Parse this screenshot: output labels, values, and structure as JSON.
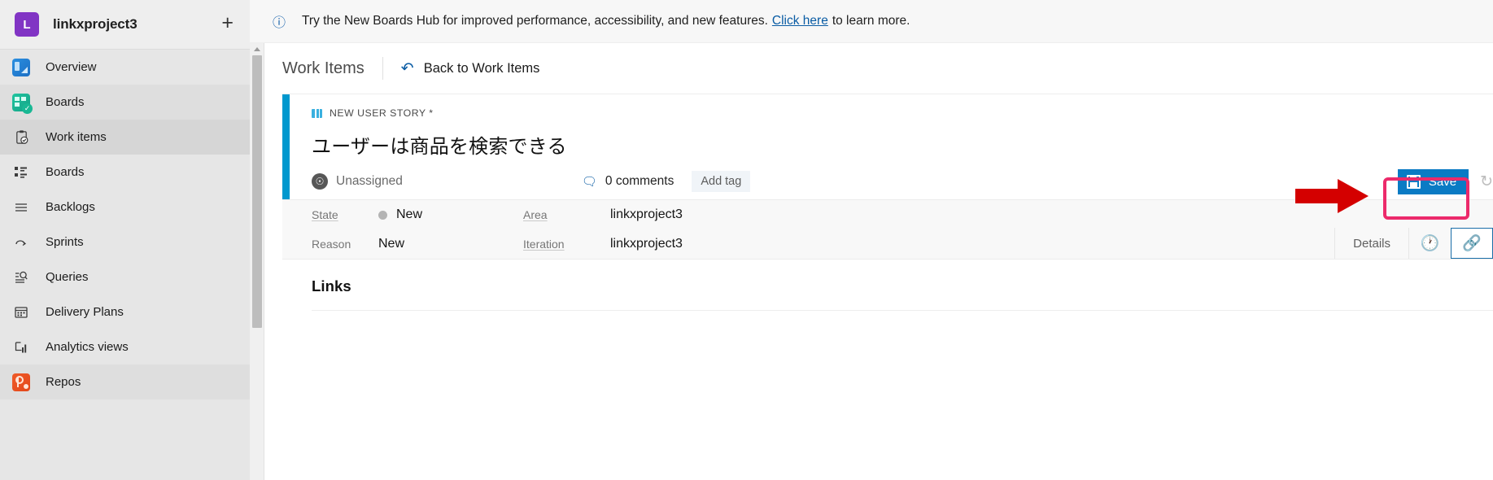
{
  "sidebar": {
    "project": {
      "initial": "L",
      "name": "linkxproject3",
      "add_label": "+"
    },
    "items": [
      {
        "label": "Overview",
        "icon": "overview-squircle-icon",
        "state": "normal"
      },
      {
        "label": "Boards",
        "icon": "boards-squircle-icon",
        "state": "group"
      },
      {
        "label": "Work items",
        "icon": "work-items-icon",
        "state": "selected"
      },
      {
        "label": "Boards",
        "icon": "boards-grid-icon",
        "state": "normal"
      },
      {
        "label": "Backlogs",
        "icon": "backlogs-icon",
        "state": "normal"
      },
      {
        "label": "Sprints",
        "icon": "sprints-icon",
        "state": "normal"
      },
      {
        "label": "Queries",
        "icon": "queries-icon",
        "state": "normal"
      },
      {
        "label": "Delivery Plans",
        "icon": "delivery-plans-icon",
        "state": "normal"
      },
      {
        "label": "Analytics views",
        "icon": "analytics-views-icon",
        "state": "normal"
      },
      {
        "label": "Repos",
        "icon": "repos-squircle-icon",
        "state": "normal"
      }
    ]
  },
  "banner": {
    "icon": "info-icon",
    "text_before": "Try the New Boards Hub for improved performance, accessibility, and new features.",
    "link": "Click here",
    "text_after": "to learn more."
  },
  "breadcrumb": {
    "title": "Work Items",
    "back_icon": "undo-arrow-icon",
    "back_label": "Back to Work Items"
  },
  "work_item": {
    "type_icon": "user-story-book-icon",
    "type_label": "NEW USER STORY *",
    "title": "ユーザーは商品を検索できる",
    "assignee_icon": "person-avatar-icon",
    "assignee": "Unassigned",
    "comments_icon": "comment-bubble-icon",
    "comments": "0 comments",
    "add_tag": "Add tag",
    "accent_color": "#0098ce"
  },
  "actions": {
    "save_icon": "save-floppy-icon",
    "save_label": "Save",
    "refresh_icon": "refresh-icon",
    "save_button_color": "#0a7bc4"
  },
  "fields": {
    "state_label": "State",
    "state_value": "New",
    "state_dot_color": "#b4b4b4",
    "reason_label": "Reason",
    "reason_value": "New",
    "area_label": "Area",
    "area_value": "linkxproject3",
    "iteration_label": "Iteration",
    "iteration_value": "linkxproject3"
  },
  "tabs": {
    "details_label": "Details",
    "history_icon": "history-clock-icon",
    "links_icon": "link-chain-icon",
    "active": "links"
  },
  "links_section": {
    "title": "Links"
  },
  "annotations": {
    "arrow_color": "#d40000",
    "highlight_color": "#ec2a6b"
  }
}
